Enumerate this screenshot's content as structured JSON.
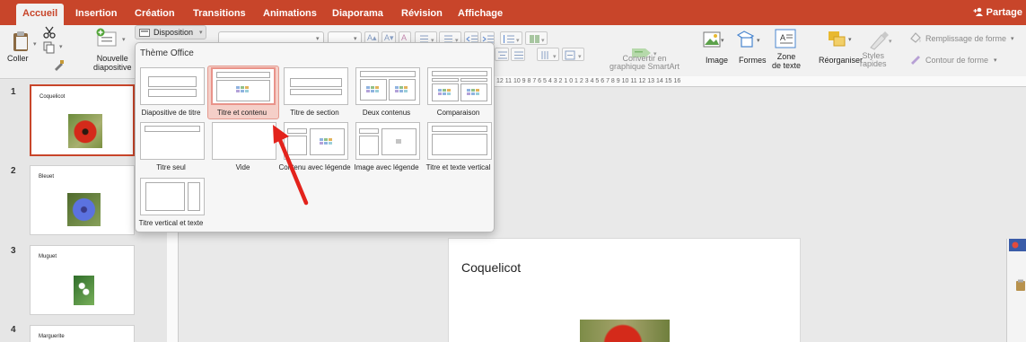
{
  "tabs": [
    {
      "label": "Accueil",
      "active": true
    },
    {
      "label": "Insertion"
    },
    {
      "label": "Création"
    },
    {
      "label": "Transitions"
    },
    {
      "label": "Animations"
    },
    {
      "label": "Diaporama"
    },
    {
      "label": "Révision"
    },
    {
      "label": "Affichage"
    }
  ],
  "share_label": "Partage",
  "ribbon": {
    "coller": "Coller",
    "nouvelle_line1": "Nouvelle",
    "nouvelle_line2": "diapositive",
    "disposition": "Disposition",
    "convertir_line1": "Convertir en",
    "convertir_line2": "graphique SmartArt",
    "image": "Image",
    "formes": "Formes",
    "zone_line1": "Zone",
    "zone_line2": "de texte",
    "reorganiser": "Réorganiser",
    "styles_line1": "Styles",
    "styles_line2": "rapides",
    "remplissage": "Remplissage de forme",
    "contour": "Contour de forme"
  },
  "ruler_text": "12 11 10 9 8 7 6 5 4 3 2 1 0 1 2 3 4 5 6 7 8 9 10 11 12 13 14 15 16",
  "popup": {
    "title": "Thème Office",
    "layouts": [
      {
        "name": "Diapositive de titre"
      },
      {
        "name": "Titre et contenu",
        "selected": true
      },
      {
        "name": "Titre de section"
      },
      {
        "name": "Deux contenus"
      },
      {
        "name": "Comparaison"
      },
      {
        "name": "Titre seul"
      },
      {
        "name": "Vide"
      },
      {
        "name": "Contenu avec légende"
      },
      {
        "name": "Image avec légende"
      },
      {
        "name": "Titre et texte vertical"
      },
      {
        "name": "Titre vertical et texte"
      }
    ]
  },
  "slides": [
    {
      "number": "1",
      "title": "Coquelicot",
      "selected": true,
      "flower_color": "#d42a1a"
    },
    {
      "number": "2",
      "title": "Bleuet",
      "flower_color": "#4f6ad8"
    },
    {
      "number": "3",
      "title": "Muguet",
      "flower_color": "#f4f4f4"
    },
    {
      "number": "4",
      "title": "Marguerite"
    }
  ],
  "current_slide": {
    "title": "Coquelicot"
  },
  "colors": {
    "accent": "#c8452a",
    "selection": "#e9938a",
    "arrow": "#e3231c"
  }
}
